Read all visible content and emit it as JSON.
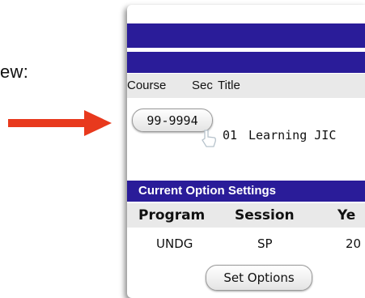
{
  "left_label": "ew:",
  "arrow_color": "#e8391d",
  "table": {
    "headers": {
      "course": "Course",
      "sec": "Sec",
      "title": "Title"
    },
    "row": {
      "course": "99-9994",
      "sec": "01",
      "title": "Learning JIC"
    }
  },
  "options": {
    "title": "Current Option Settings",
    "headers": {
      "program": "Program",
      "session": "Session",
      "year": "Ye"
    },
    "values": {
      "program": "UNDG",
      "session": "SP",
      "year": "20"
    },
    "button_label": "Set Options"
  },
  "colors": {
    "bar": "#2a1c99",
    "header_bg": "#e9e9e9"
  }
}
